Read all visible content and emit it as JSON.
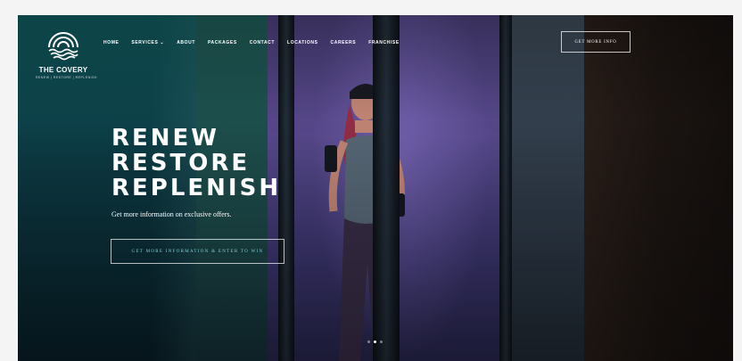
{
  "brand": {
    "name": "THE COVERY",
    "tagline": "RENEW | RESTORE | REPLENISH"
  },
  "nav": {
    "items": [
      {
        "label": "HOME"
      },
      {
        "label": "SERVICES"
      },
      {
        "label": "ABOUT"
      },
      {
        "label": "PACKAGES"
      },
      {
        "label": "CONTACT"
      },
      {
        "label": "LOCATIONS"
      },
      {
        "label": "CAREERS"
      },
      {
        "label": "FRANCHISE"
      }
    ],
    "services_dropdown_icon": "chevron-down-icon"
  },
  "header_cta": {
    "label": "GET MORE INFO"
  },
  "hero": {
    "headline": [
      "RENEW",
      "RESTORE",
      "REPLENISH"
    ],
    "subtext": "Get more information on exclusive offers.",
    "cta_label": "GET MORE INFORMATION & ENTER TO WIN"
  },
  "slider": {
    "count": 3,
    "active_index": 1
  },
  "colors": {
    "accent": "#7fd3d6",
    "text": "#ffffff"
  }
}
